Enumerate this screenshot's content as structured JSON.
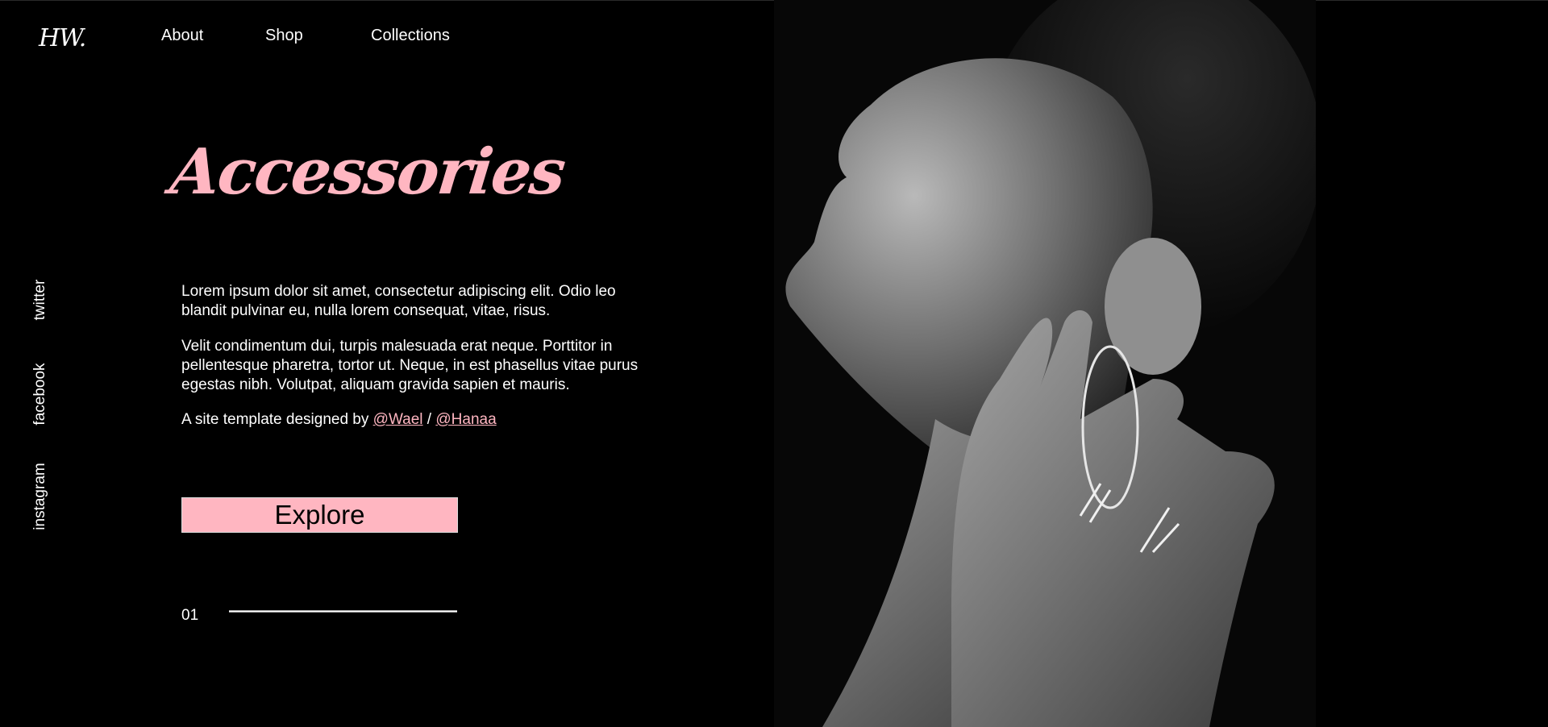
{
  "brand": {
    "logo": "HW."
  },
  "nav": {
    "items": [
      "About",
      "Shop",
      "Collections"
    ]
  },
  "social": {
    "items": [
      "twitter",
      "facebook",
      "instagram"
    ]
  },
  "hero": {
    "title": "Accessories",
    "paragraph1": "Lorem ipsum dolor sit amet, consectetur adipiscing elit. Odio leo blandit pulvinar eu, nulla lorem consequat, vitae, risus.",
    "paragraph2": "Velit condimentum dui, turpis malesuada erat neque. Porttitor in pellentesque pharetra, tortor ut. Neque, in est phasellus vitae purus egestas nibh. Volutpat, aliquam gravida sapien et mauris.",
    "credit_prefix": "A site template designed by ",
    "credit_link1": "@Wael",
    "credit_separator": " / ",
    "credit_link2": "@Hanaa",
    "button_label": "Explore"
  },
  "slider": {
    "current": "01",
    "progress": 1.0
  },
  "image": {
    "subject": "black-and-white portrait of a woman wearing a silver hoop earring and geometric rings"
  },
  "colors": {
    "accent": "#ffb6c1",
    "background": "#000000",
    "text": "#ffffff"
  }
}
